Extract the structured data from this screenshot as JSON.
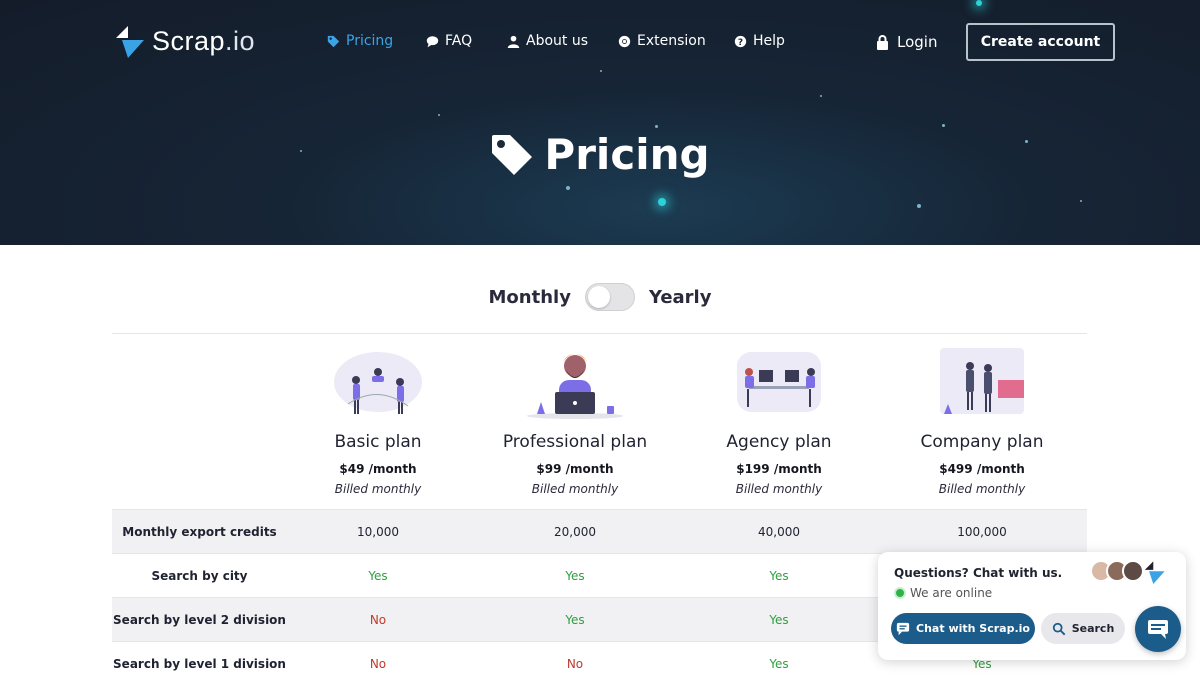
{
  "brand": {
    "name_main": "Scrap",
    "name_suffix": ".io"
  },
  "nav": {
    "items": [
      {
        "label": "Pricing",
        "icon": "tag-icon",
        "active": true
      },
      {
        "label": "FAQ",
        "icon": "comment-icon"
      },
      {
        "label": "About us",
        "icon": "user-icon"
      },
      {
        "label": "Extension",
        "icon": "chrome-icon"
      },
      {
        "label": "Help",
        "icon": "question-icon"
      }
    ],
    "login": "Login",
    "create_account": "Create account"
  },
  "hero": {
    "title": "Pricing"
  },
  "billing": {
    "monthly": "Monthly",
    "yearly": "Yearly",
    "yearly_selected": false
  },
  "plans": [
    {
      "name": "Basic plan",
      "price": "$49",
      "period": "/month",
      "billed": "Billed monthly"
    },
    {
      "name": "Professional plan",
      "price": "$99",
      "period": "/month",
      "billed": "Billed monthly"
    },
    {
      "name": "Agency plan",
      "price": "$199",
      "period": "/month",
      "billed": "Billed monthly"
    },
    {
      "name": "Company plan",
      "price": "$499",
      "period": "/month",
      "billed": "Billed monthly"
    }
  ],
  "features": [
    {
      "label": "Monthly export credits",
      "values": [
        "10,000",
        "20,000",
        "40,000",
        "100,000"
      ]
    },
    {
      "label": "Search by city",
      "values": [
        "Yes",
        "Yes",
        "Yes",
        ""
      ]
    },
    {
      "label": "Search by level 2 division",
      "values": [
        "No",
        "Yes",
        "Yes",
        ""
      ]
    },
    {
      "label": "Search by level 1 division",
      "values": [
        "No",
        "No",
        "Yes",
        "Yes"
      ]
    }
  ],
  "chat": {
    "question": "Questions? Chat with us.",
    "status": "We are online",
    "chat_button": "Chat with Scrap.io",
    "search_button": "Search"
  },
  "colors": {
    "accent": "#3aa3e6",
    "brand_dark": "#1c5c8a",
    "yes": "#2e9e3f",
    "no": "#c0392b"
  }
}
